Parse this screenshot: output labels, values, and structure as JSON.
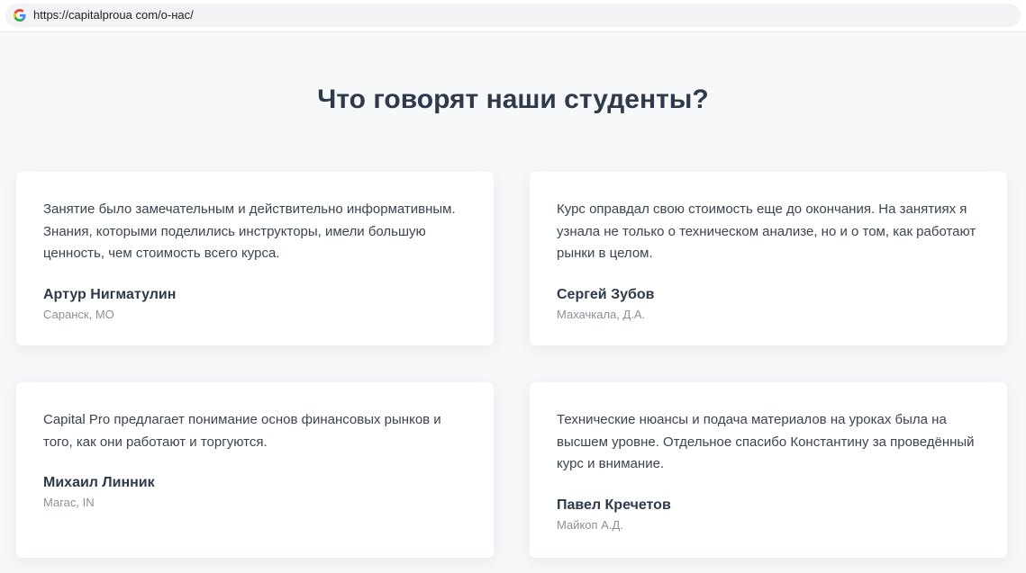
{
  "browser": {
    "url": "https://capitalproua com/о-нас/"
  },
  "section": {
    "title": "Что говорят наши студенты?"
  },
  "testimonials": [
    {
      "quote": "Занятие было замечательным и действительно информативным. Знания, которыми поделились инструкторы, имели большую ценность, чем стоимость всего курса.",
      "author": "Артур Нигматулин",
      "location": "Саранск, МО"
    },
    {
      "quote": "Курс оправдал свою стоимость еще до окончания. На занятиях я узнала не только о техническом анализе, но и о том, как работают рынки в целом.",
      "author": "Сергей Зубов",
      "location": "Махачкала, Д.А."
    },
    {
      "quote": "Capital Pro предлагает понимание основ финансовых рынков и того, как они работают и торгуются.",
      "author": "Михаил Линник",
      "location": "Магас, IN"
    },
    {
      "quote": "Технические нюансы и подача материалов на уроках была на высшем уровне. Отдельное спасибо Константину за проведённый курс и внимание.",
      "author": "Павел Кречетов",
      "location": "Майкоп А.Д."
    }
  ]
}
